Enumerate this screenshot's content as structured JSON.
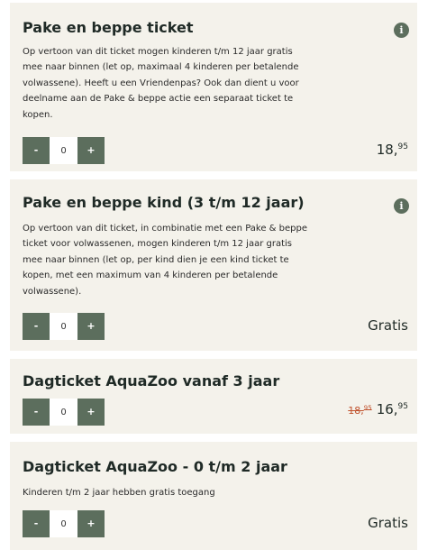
{
  "tickets": [
    {
      "title": "Pake en beppe ticket",
      "description": "Op vertoon van dit ticket mogen kinderen t/m 12 jaar gratis mee naar binnen (let op, maximaal 4 kinderen per betalende volwassene). Heeft u een Vriendenpas? Ook dan dient u voor deelname aan de Pake & beppe actie een separaat ticket te kopen.",
      "info_icon": "i",
      "quantity": "0",
      "price_main": "18,",
      "price_cents": "95"
    },
    {
      "title": "Pake en beppe kind (3 t/m 12 jaar)",
      "description": "Op vertoon van dit ticket, in combinatie met een Pake & beppe ticket voor volwassenen, mogen kinderen t/m 12 jaar gratis mee naar binnen (let op, per kind dien je een kind ticket te kopen, met een maximum van 4 kinderen per betalende volwassene).",
      "info_icon": "i",
      "quantity": "0",
      "price_label": "Gratis"
    },
    {
      "title": "Dagticket AquaZoo vanaf 3 jaar",
      "quantity": "0",
      "old_price_main": "18,",
      "old_price_cents": "95",
      "price_main": "16,",
      "price_cents": "95"
    },
    {
      "title": "Dagticket AquaZoo - 0 t/m 2 jaar",
      "description": "Kinderen t/m 2 jaar hebben gratis toegang",
      "quantity": "0",
      "price_label": "Gratis"
    }
  ],
  "stepper": {
    "minus_label": "-",
    "plus_label": "+"
  },
  "colors": {
    "card_background": "#f4f2eb",
    "button_green": "#5c6e5d",
    "title_text": "#1f2a26",
    "old_price_red": "#c0522d"
  },
  "icons": {
    "info": "info-icon"
  }
}
